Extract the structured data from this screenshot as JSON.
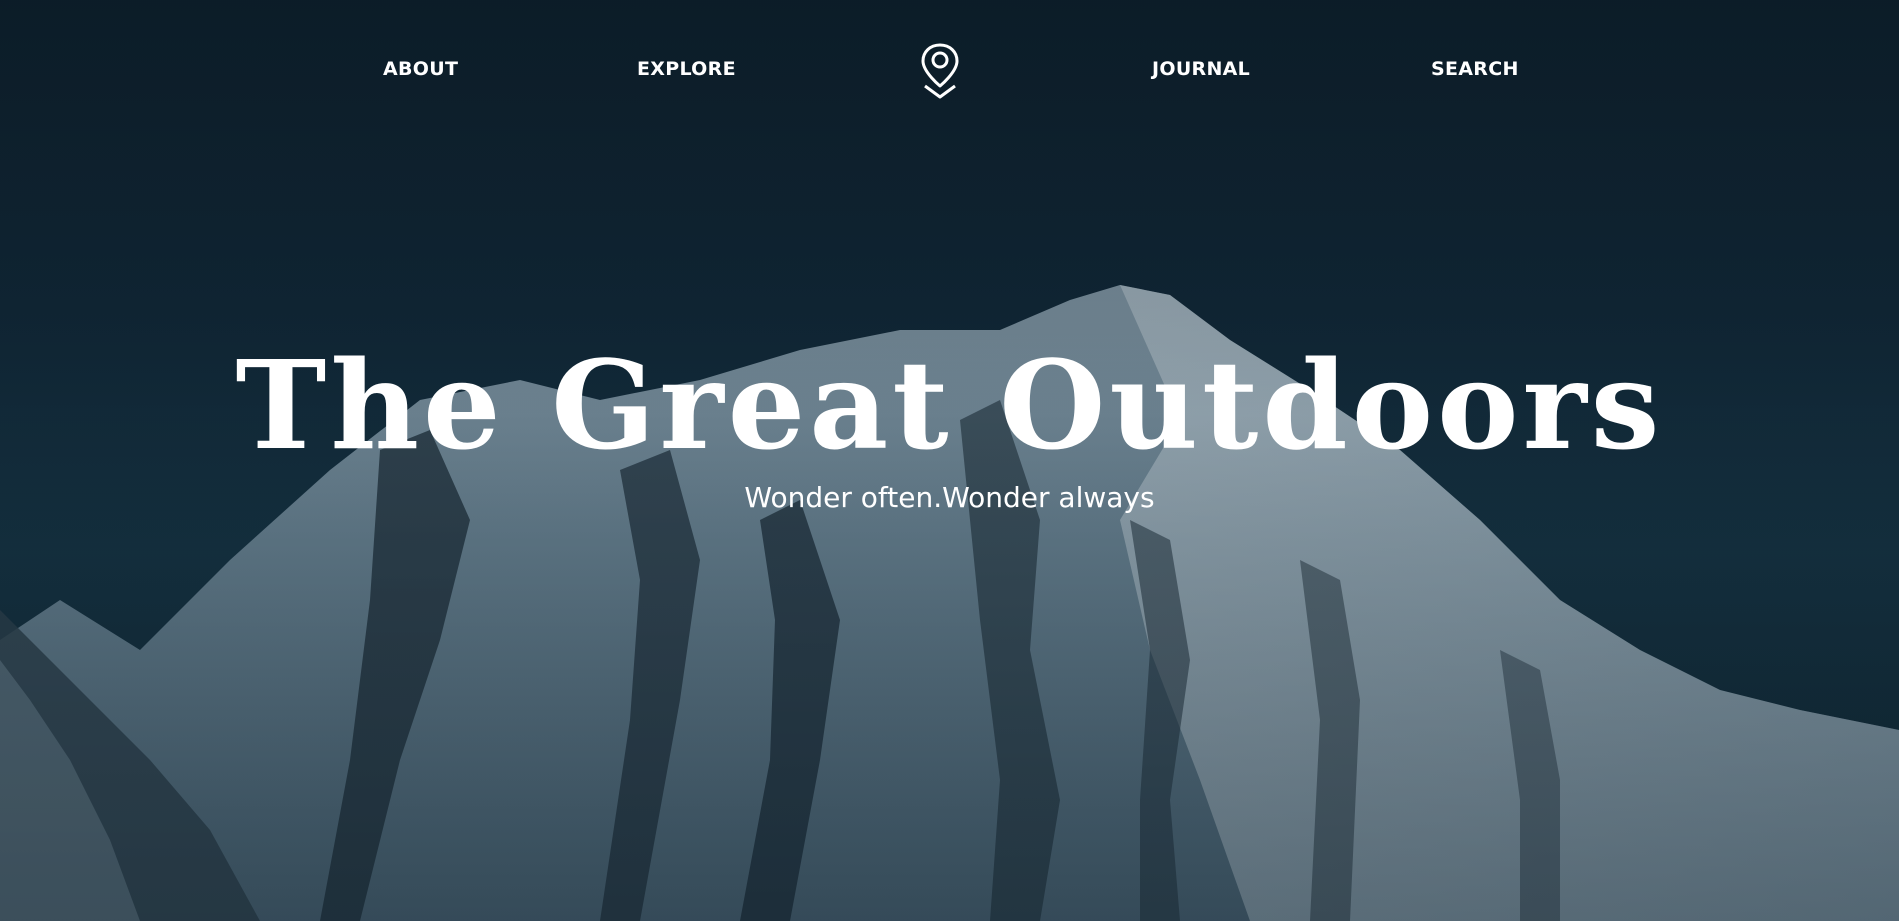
{
  "nav": {
    "items": [
      {
        "label": "ABOUT"
      },
      {
        "label": "EXPLORE"
      },
      {
        "label": "JOURNAL"
      },
      {
        "label": "SEARCH"
      }
    ],
    "logo_icon": "map-pin-icon"
  },
  "hero": {
    "title": "The Great Outdoors",
    "subtitle": "Wonder often.Wonder always"
  },
  "colors": {
    "sky": "#0f2230",
    "text": "#ffffff",
    "snow": "#c9d6dd",
    "rock": "#1a2a35"
  }
}
